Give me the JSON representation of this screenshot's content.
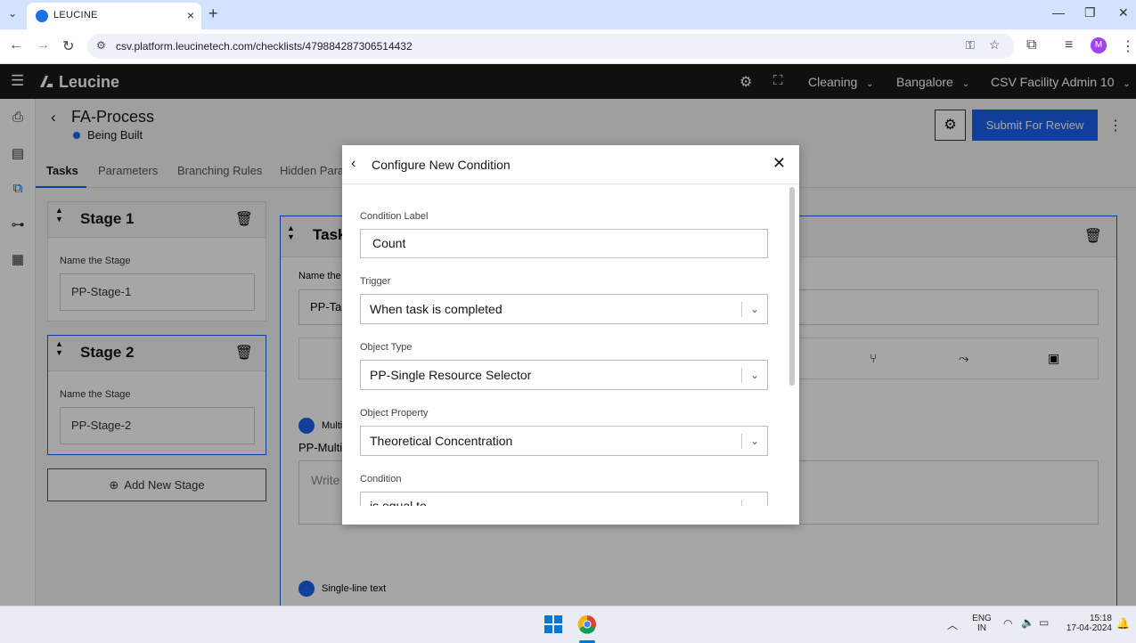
{
  "browser": {
    "tab_title": "LEUCINE",
    "url": "csv.platform.leucinetech.com/checklists/479884287306514432",
    "profile_initial": "M"
  },
  "app": {
    "logo": "Leucine",
    "header": {
      "facility_mode": "Cleaning",
      "location": "Bangalore",
      "user": "CSV Facility Admin 10"
    }
  },
  "checklist": {
    "title": "FA-Process",
    "status": "Being Built",
    "submit_label": "Submit For Review",
    "tabs": [
      "Tasks",
      "Parameters",
      "Branching Rules",
      "Hidden Param"
    ]
  },
  "stages": [
    {
      "title": "Stage 1",
      "name_label": "Name the Stage",
      "name_value": "PP-Stage-1"
    },
    {
      "title": "Stage 2",
      "name_label": "Name the Stage",
      "name_value": "PP-Stage-2"
    }
  ],
  "add_stage_label": "Add New Stage",
  "task": {
    "title_fragment": "Task",
    "name_label_fragment": "Name the t",
    "name_value_fragment": "PP-Ta",
    "param1_type": "Multi",
    "param1_name": "PP-Multi",
    "param1_placeholder": "Write",
    "param2_type": "Single-line text"
  },
  "modal": {
    "title": "Configure New Condition",
    "fields": {
      "label": {
        "label": "Condition Label",
        "value": "Count"
      },
      "trigger": {
        "label": "Trigger",
        "value": "When task is completed"
      },
      "object_type": {
        "label": "Object Type",
        "value": "PP-Single Resource Selector"
      },
      "object_property": {
        "label": "Object Property",
        "value": "Theoretical Concentration"
      },
      "condition": {
        "label": "Condition",
        "value": "is equal to"
      }
    }
  },
  "taskbar": {
    "lang_line1": "ENG",
    "lang_line2": "IN",
    "time": "15:18",
    "date": "17-04-2024"
  },
  "colors": {
    "primary": "#1d62f0",
    "header_bg": "#1a1a1a"
  }
}
